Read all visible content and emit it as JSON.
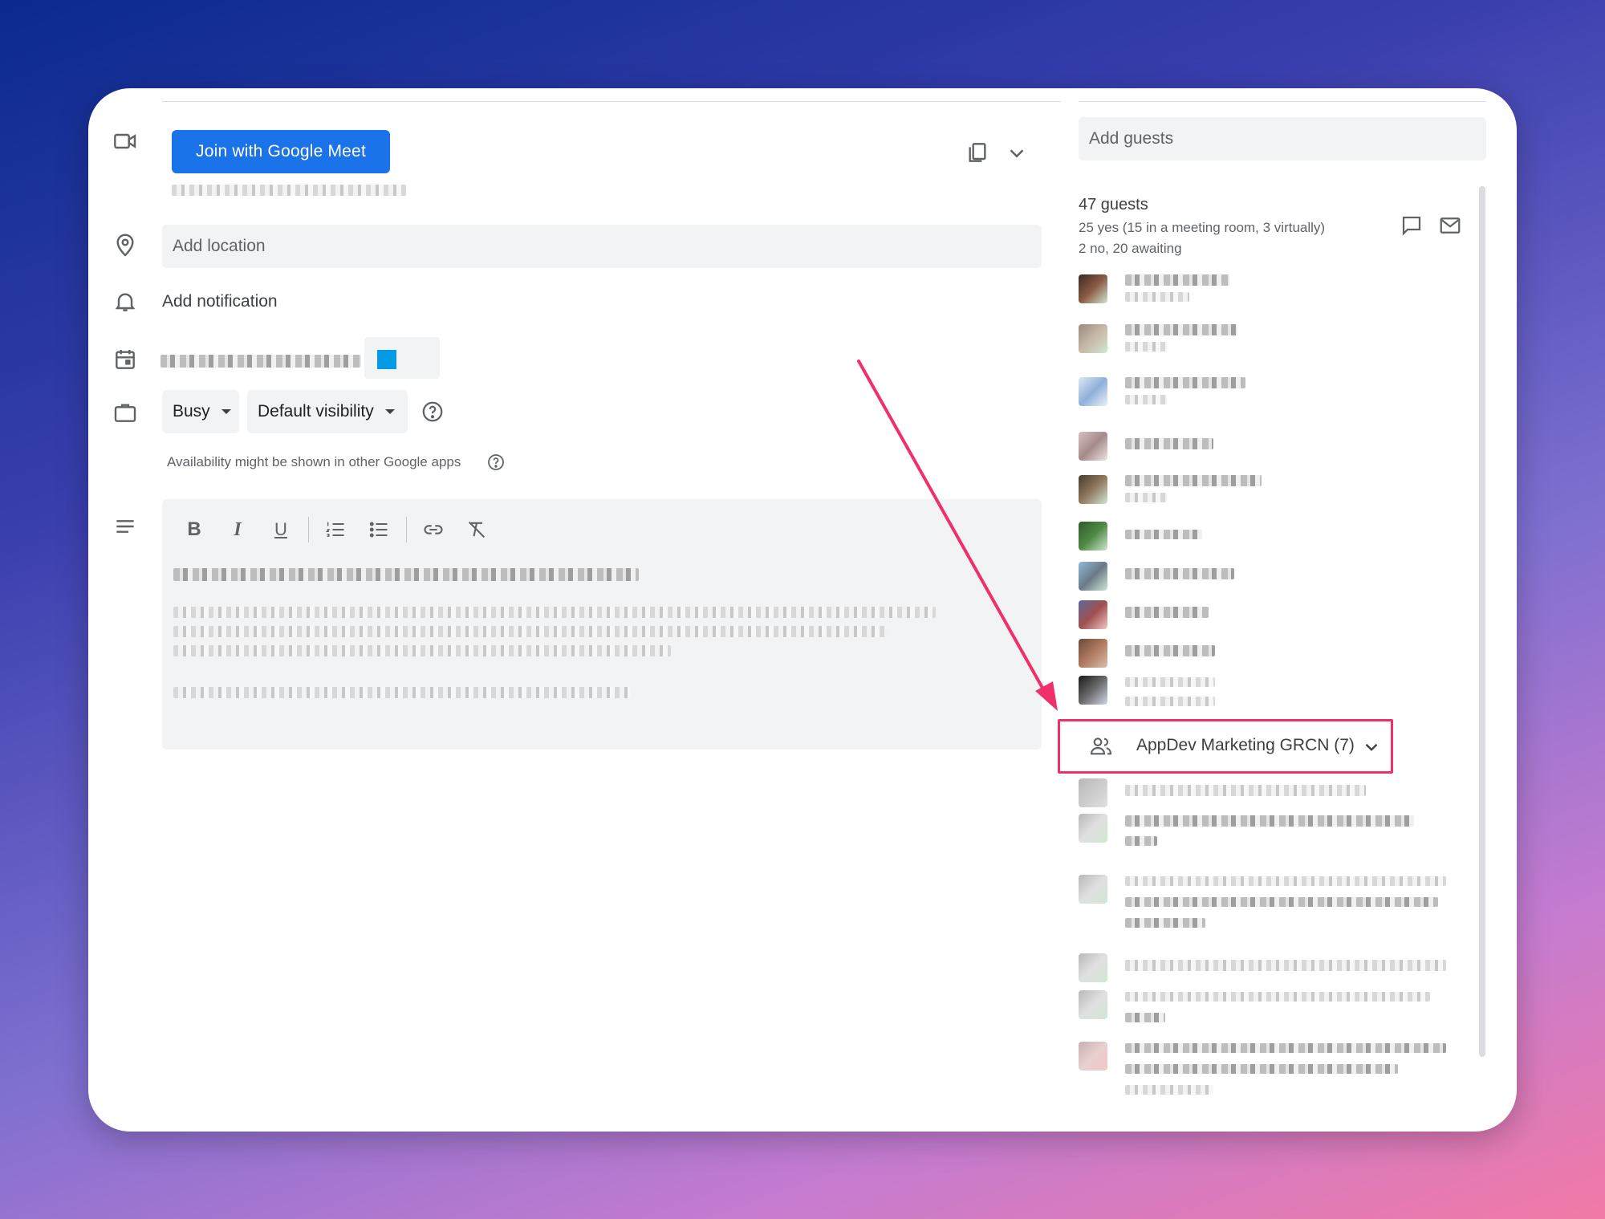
{
  "meet": {
    "join_label": "Join with Google Meet"
  },
  "location": {
    "placeholder": "Add location"
  },
  "notification": {
    "label": "Add notification"
  },
  "availability": {
    "status": "Busy",
    "visibility": "Default visibility",
    "note": "Availability might be shown in other Google apps"
  },
  "guests": {
    "placeholder": "Add guests",
    "count": "47 guests",
    "summary_yes": "25 yes (15 in a meeting room, 3 virtually)",
    "summary_no": "2 no, 20 awaiting",
    "group_label": "AppDev Marketing GRCN (7)"
  },
  "icons": {
    "video": "video-camera-icon",
    "location": "map-pin-icon",
    "notification": "bell-icon",
    "calendar": "calendar-icon",
    "briefcase": "briefcase-icon",
    "description": "description-lines-icon",
    "help": "help-circle-icon",
    "copy": "copy-icon",
    "expand": "chevron-down-icon",
    "chat": "chat-icon",
    "email": "email-icon",
    "group": "group-icon"
  },
  "colors": {
    "meet_button": "#1a73e8",
    "highlight": "#f0306b",
    "arrow": "#f0306b"
  }
}
